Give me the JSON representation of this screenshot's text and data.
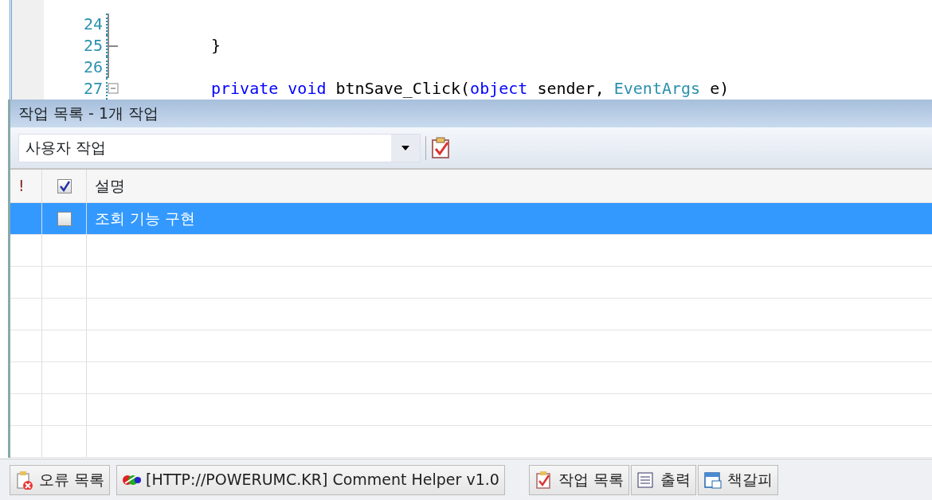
{
  "editor": {
    "lines": [
      {
        "number": "24",
        "kind": "fold_line"
      },
      {
        "number": "25",
        "tokens": [
          {
            "kind": "plain",
            "text": "}"
          }
        ],
        "kind": "fold_end"
      },
      {
        "number": "26",
        "kind": "fold_line"
      },
      {
        "number": "27",
        "tokens": [
          {
            "kind": "keyword",
            "text": "private"
          },
          {
            "kind": "keyword",
            "text": "void"
          },
          {
            "kind": "plain",
            "text": "btnSave_Click(",
            "space_after": false
          },
          {
            "kind": "keyword",
            "text": "object"
          },
          {
            "kind": "plain",
            "text": "sender,"
          },
          {
            "kind": "type",
            "text": "EventArgs"
          },
          {
            "kind": "plain",
            "text": "e)"
          }
        ],
        "kind": "fold_start"
      }
    ]
  },
  "task_list": {
    "title": "작업 목록 - 1개 작업",
    "filter": "사용자 작업",
    "columns": [
      {
        "kind": "priority",
        "label": "!"
      },
      {
        "kind": "check",
        "checked": true
      },
      {
        "kind": "text",
        "label": "설명"
      }
    ],
    "rows": [
      {
        "checked": false,
        "selected": true,
        "description": "조회 기능 구현"
      }
    ]
  },
  "bottom_tabs": [
    {
      "kind": "error",
      "label": "오류 목록"
    },
    {
      "kind": "plugin",
      "label": "[HTTP://POWERUMC.KR] Comment Helper v1.0"
    },
    {
      "kind": "task",
      "label": "작업 목록"
    },
    {
      "kind": "output",
      "label": "출력"
    },
    {
      "kind": "bookmark",
      "label": "책갈피"
    }
  ]
}
